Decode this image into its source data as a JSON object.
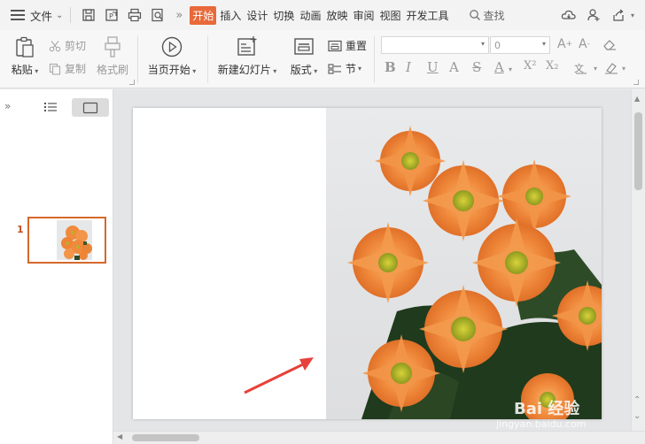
{
  "menubar": {
    "file_label": "文件",
    "tabs": [
      "开始",
      "插入",
      "设计",
      "切换",
      "动画",
      "放映",
      "审阅",
      "视图",
      "开发工具"
    ],
    "active_tab": "开始",
    "search_label": "查找",
    "more_glyph": "»"
  },
  "ribbon": {
    "paste": "粘贴",
    "cut": "剪切",
    "copy": "复制",
    "format_painter": "格式刷",
    "from_first": "当页开始",
    "new_slide": "新建幻灯片",
    "layout": "版式",
    "reset": "重置",
    "section": "节",
    "font_name_value": "",
    "font_size_value": "0",
    "format_buttons": [
      "B",
      "I",
      "U",
      "A",
      "S",
      "A",
      "X²",
      "X₂"
    ]
  },
  "left_panel": {
    "expand_glyph": "»",
    "slide_number": "1"
  },
  "watermark": {
    "brand": "Bai 经验",
    "url": "jingyan.baidu.com"
  },
  "colors": {
    "accent": "#e8693a",
    "thumb_border": "#d6672c",
    "arrow": "#e8403a",
    "flower": "#f08a3c"
  },
  "icons": [
    "menu-icon",
    "save-icon",
    "export-icon",
    "print-icon",
    "preview-icon",
    "search-icon",
    "cloud-icon",
    "user-icon",
    "share-icon",
    "paste-icon",
    "scissors-icon",
    "copy-icon",
    "brush-icon",
    "play-icon",
    "new-slide-icon",
    "layout-icon",
    "reset-icon",
    "section-icon",
    "outline-icon",
    "slides-icon"
  ]
}
